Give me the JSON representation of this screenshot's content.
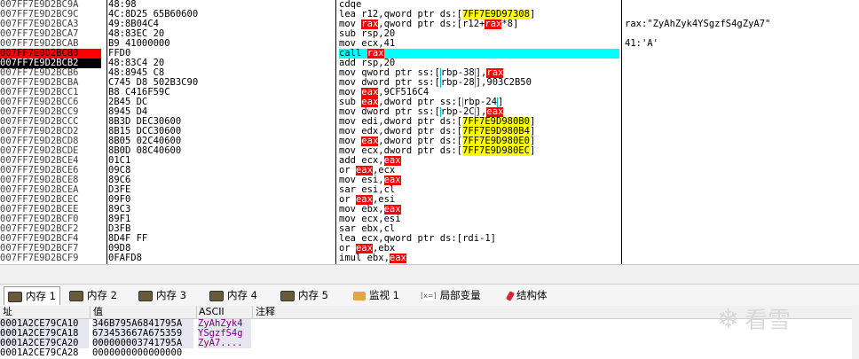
{
  "disasm": [
    {
      "addr": "007FF7E9D2BC9A",
      "bytes": "48:98",
      "instr": "cdqe",
      "comment": ""
    },
    {
      "addr": "007FF7E9D2BC9C",
      "bytes": "4C:8D25 65B60600",
      "instr_pre": "lea r12,qword ptr ds:[",
      "instr_mem": "7FF7E9D97308",
      "instr_post": "]",
      "comment": ""
    },
    {
      "addr": "007FF7E9D2BCA3",
      "bytes": "49:8B04C4",
      "instr_pre": "mov ",
      "instr_reg": "rax",
      "instr_mid": ",qword ptr ds:[r12+",
      "instr_reg2": "rax",
      "instr_post": "*8]",
      "comment": "rax:\"ZyAhZyk4YSgzfS4gZyA7\""
    },
    {
      "addr": "007FF7E9D2BCA7",
      "bytes": "48:83EC 20",
      "instr": "sub rsp,20",
      "comment": ""
    },
    {
      "addr": "007FF7E9D2BCAB",
      "bytes": "B9 41000000",
      "instr": "mov ecx,41",
      "comment": "41:'A'"
    },
    {
      "addr": "007FF7E9D2BCB0",
      "bytes": "FFD0",
      "instr_pre": "call ",
      "instr_reg": "rax",
      "comment": ""
    },
    {
      "addr": "007FF7E9D2BCB2",
      "bytes": "48:83C4 20",
      "instr": "add rsp,20",
      "comment": ""
    },
    {
      "addr": "007FF7E9D2BCB6",
      "bytes": "48:8945 C8",
      "instr_pre": "mov qword ptr ss:[",
      "instr_box": "rbp-38",
      "instr_mid": "],",
      "instr_reg": "rax",
      "comment": ""
    },
    {
      "addr": "007FF7E9D2BCBA",
      "bytes": "C745 D8 502B3C90",
      "instr_pre": "mov dword ptr ss:[",
      "instr_box": "rbp-28",
      "instr_post": "],903C2B50",
      "comment": ""
    },
    {
      "addr": "007FF7E9D2BCC1",
      "bytes": "B8 C416F59C",
      "instr_pre": "mov ",
      "instr_reg": "eax",
      "instr_post": ",9CF516C4",
      "comment": ""
    },
    {
      "addr": "007FF7E9D2BCC6",
      "bytes": "2B45 DC",
      "instr_pre": "sub ",
      "instr_reg": "eax",
      "instr_mid": ",dword ptr ss:[",
      "instr_box": "rbp-24",
      "instr_post": "]",
      "comment": ""
    },
    {
      "addr": "007FF7E9D2BCC9",
      "bytes": "8945 D4",
      "instr_pre": "mov dword ptr ss:[",
      "instr_box": "rbp-2C",
      "instr_mid": "],",
      "instr_reg": "eax",
      "comment": ""
    },
    {
      "addr": "007FF7E9D2BCCC",
      "bytes": "8B3D DEC30600",
      "instr_pre": "mov edi,dword ptr ds:[",
      "instr_mem": "7FF7E9D980B0",
      "instr_post": "]",
      "comment": ""
    },
    {
      "addr": "007FF7E9D2BCD2",
      "bytes": "8B15 DCC30600",
      "instr_pre": "mov edx,dword ptr ds:[",
      "instr_mem": "7FF7E9D980B4",
      "instr_post": "]",
      "comment": ""
    },
    {
      "addr": "007FF7E9D2BCD8",
      "bytes": "8B05 02C40600",
      "instr_pre": "mov ",
      "instr_reg": "eax",
      "instr_mid": ",dword ptr ds:[",
      "instr_mem": "7FF7E9D980E0",
      "instr_post": "]",
      "comment": ""
    },
    {
      "addr": "007FF7E9D2BCDE",
      "bytes": "8B0D 08C40600",
      "instr_pre": "mov ecx,dword ptr ds:[",
      "instr_mem": "7FF7E9D980EC",
      "instr_post": "]",
      "comment": ""
    },
    {
      "addr": "007FF7E9D2BCE4",
      "bytes": "01C1",
      "instr_pre": "add ecx,",
      "instr_reg": "eax",
      "comment": ""
    },
    {
      "addr": "007FF7E9D2BCE6",
      "bytes": "09C8",
      "instr_pre": "or ",
      "instr_reg": "eax",
      "instr_post": ",ecx",
      "comment": ""
    },
    {
      "addr": "007FF7E9D2BCE8",
      "bytes": "89C6",
      "instr_pre": "mov esi,",
      "instr_reg": "eax",
      "comment": ""
    },
    {
      "addr": "007FF7E9D2BCEA",
      "bytes": "D3FE",
      "instr": "sar esi,cl",
      "comment": ""
    },
    {
      "addr": "007FF7E9D2BCEC",
      "bytes": "09F0",
      "instr_pre": "or ",
      "instr_reg": "eax",
      "instr_post": ",esi",
      "comment": ""
    },
    {
      "addr": "007FF7E9D2BCEE",
      "bytes": "89C3",
      "instr_pre": "mov ebx,",
      "instr_reg": "eax",
      "comment": ""
    },
    {
      "addr": "007FF7E9D2BCF0",
      "bytes": "89F1",
      "instr": "mov ecx,esi",
      "comment": ""
    },
    {
      "addr": "007FF7E9D2BCF2",
      "bytes": "D3FB",
      "instr": "sar ebx,cl",
      "comment": ""
    },
    {
      "addr": "007FF7E9D2BCF4",
      "bytes": "8D4F FF",
      "instr": "lea ecx,qword ptr ds:[rdi-1]",
      "comment": ""
    },
    {
      "addr": "007FF7E9D2BCF7",
      "bytes": "09D8",
      "instr_pre": "or ",
      "instr_reg": "eax",
      "instr_post": ",ebx",
      "comment": ""
    },
    {
      "addr": "007FF7E9D2BCF9",
      "bytes": "0FAFD8",
      "instr_pre": "imul ebx,",
      "instr_reg": "eax",
      "comment": ""
    }
  ],
  "breakpoint_index": 5,
  "current_index": 6,
  "tabs": [
    {
      "label": "内存 1",
      "icon": "memory-icon"
    },
    {
      "label": "内存 2",
      "icon": "memory-icon"
    },
    {
      "label": "内存 3",
      "icon": "memory-icon"
    },
    {
      "label": "内存 4",
      "icon": "memory-icon"
    },
    {
      "label": "内存 5",
      "icon": "memory-icon"
    },
    {
      "label": "监视 1",
      "icon": "watch-icon"
    },
    {
      "label": "局部变量",
      "icon": "locals-icon",
      "icon_text": "[x=]"
    },
    {
      "label": "结构体",
      "icon": "struct-icon"
    }
  ],
  "memory": {
    "headers": {
      "addr": "址",
      "value": "值",
      "ascii": "ASCII",
      "comment": "注释"
    },
    "rows": [
      {
        "addr": "0001A2CE79CA10",
        "value": "346B795A6841795A",
        "ascii": "ZyAhZyk4"
      },
      {
        "addr": "0001A2CE79CA18",
        "value": "673453667A675359",
        "ascii": "YSgzfS4g"
      },
      {
        "addr": "0001A2CE79CA20",
        "value": "000000003741795A",
        "ascii": "ZyA7...."
      },
      {
        "addr": "0001A2CE79CA28",
        "value": "0000000000000000",
        "ascii": ""
      }
    ]
  },
  "watermark": {
    "text": "看雪"
  },
  "colors": {
    "breakpoint": "#ff0000",
    "current": "#000000",
    "call_highlight": "#00ffff",
    "register": "#ff0000",
    "memory_ref": "#ffff00"
  }
}
